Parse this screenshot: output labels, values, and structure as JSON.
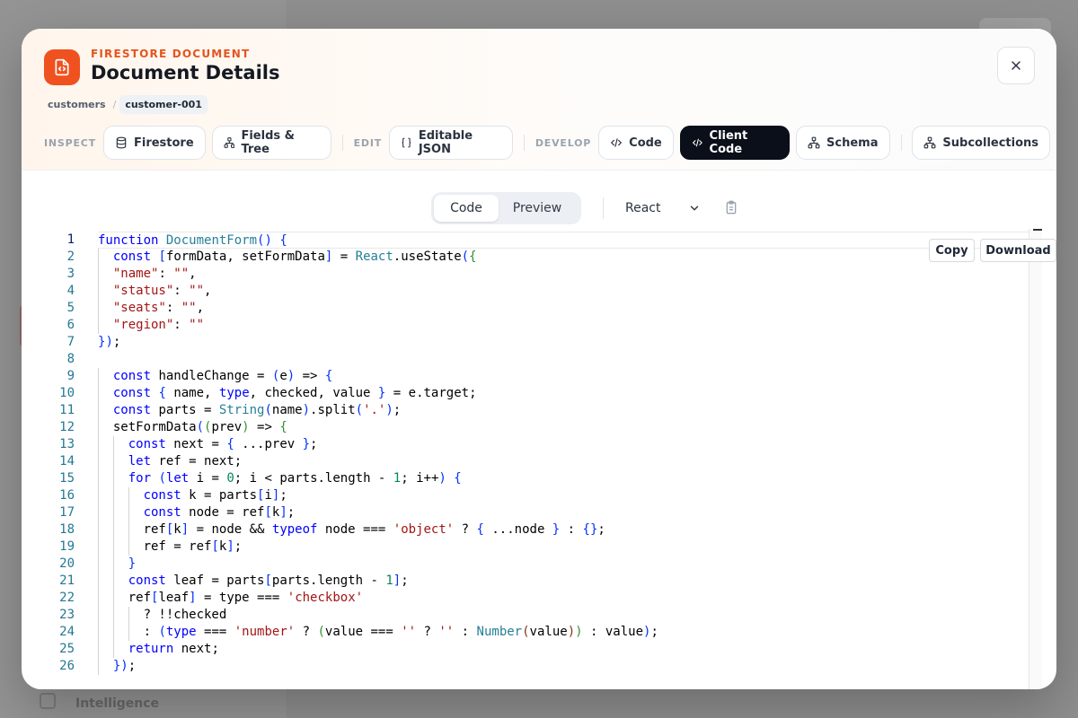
{
  "background": {
    "sidebar_label": "Intelligence"
  },
  "header": {
    "eyebrow": "FIRESTORE DOCUMENT",
    "title": "Document Details",
    "breadcrumb": [
      "customers",
      "customer-001"
    ]
  },
  "toolbar": {
    "groups": [
      {
        "label": "INSPECT",
        "buttons": [
          {
            "label": "Firestore",
            "icon": "database-icon"
          },
          {
            "label": "Fields & Tree",
            "icon": "tree-icon"
          }
        ]
      },
      {
        "label": "EDIT",
        "buttons": [
          {
            "label": "Editable JSON",
            "icon": "braces-icon"
          }
        ]
      },
      {
        "label": "DEVELOP",
        "buttons": [
          {
            "label": "Code",
            "icon": "code-icon"
          },
          {
            "label": "Client Code",
            "icon": "code-icon",
            "active": true
          },
          {
            "label": "Schema",
            "icon": "tree-icon"
          }
        ]
      },
      {
        "label": "",
        "buttons": [
          {
            "label": "Subcollections",
            "icon": "tree-icon"
          }
        ]
      }
    ]
  },
  "view": {
    "tabs": [
      "Code",
      "Preview"
    ],
    "active_tab": "Code",
    "framework": "React"
  },
  "editor": {
    "copy_label": "Copy",
    "download_label": "Download",
    "current_line": 1,
    "lines": [
      "function DocumentForm() {",
      "  const [formData, setFormData] = React.useState({",
      "  \"name\": \"\",",
      "  \"status\": \"\",",
      "  \"seats\": \"\",",
      "  \"region\": \"\"",
      "});",
      "",
      "  const handleChange = (e) => {",
      "  const { name, type, checked, value } = e.target;",
      "  const parts = String(name).split('.');",
      "  setFormData((prev) => {",
      "    const next = { ...prev };",
      "    let ref = next;",
      "    for (let i = 0; i < parts.length - 1; i++) {",
      "      const k = parts[i];",
      "      const node = ref[k];",
      "      ref[k] = node && typeof node === 'object' ? { ...node } : {};",
      "      ref = ref[k];",
      "    }",
      "    const leaf = parts[parts.length - 1];",
      "    ref[leaf] = type === 'checkbox'",
      "      ? !!checked",
      "      : (type === 'number' ? (value === '' ? '' : Number(value)) : value);",
      "    return next;",
      "  });"
    ]
  }
}
